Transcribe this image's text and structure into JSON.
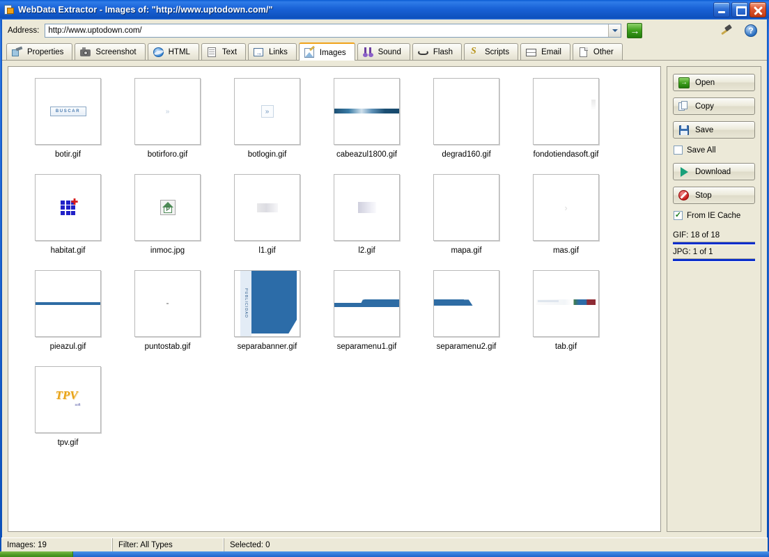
{
  "window": {
    "title": "WebData Extractor - Images of: \"http://www.uptodown.com/\"",
    "icon": "webdata-extractor-icon",
    "minimize_label": "Minimize",
    "maximize_label": "Maximize",
    "close_label": "Close"
  },
  "toolbar": {
    "address_label": "Address:",
    "address_value": "http://www.uptodown.com/",
    "address_placeholder": "http://",
    "go_label": "Go",
    "tools_icon": "hammer-icon",
    "help_icon": "help-icon",
    "help_glyph": "?"
  },
  "tabs": [
    {
      "label": "Properties",
      "icon": "properties-icon",
      "active": false
    },
    {
      "label": "Screenshot",
      "icon": "camera-icon",
      "active": false
    },
    {
      "label": "HTML",
      "icon": "browser-icon",
      "active": false
    },
    {
      "label": "Text",
      "icon": "document-icon",
      "active": false
    },
    {
      "label": "Links",
      "icon": "link-arrow-icon",
      "active": false
    },
    {
      "label": "Images",
      "icon": "image-icon",
      "active": true
    },
    {
      "label": "Sound",
      "icon": "music-note-icon",
      "active": false
    },
    {
      "label": "Flash",
      "icon": "flash-icon",
      "active": false
    },
    {
      "label": "Scripts",
      "icon": "script-icon",
      "active": false
    },
    {
      "label": "Email",
      "icon": "envelope-icon",
      "active": false
    },
    {
      "label": "Other",
      "icon": "file-icon",
      "active": false
    }
  ],
  "images": [
    {
      "name": "botir.gif",
      "art": "buscar",
      "art_text": "BUSCAR"
    },
    {
      "name": "botirforo.gif",
      "art": "chevron",
      "art_text": "»"
    },
    {
      "name": "botlogin.gif",
      "art": "chevron-box",
      "art_text": "»"
    },
    {
      "name": "cabeazul1800.gif",
      "art": "band",
      "art_text": ""
    },
    {
      "name": "degrad160.gif",
      "art": "blank",
      "art_text": ""
    },
    {
      "name": "fondotiendasoft.gif",
      "art": "corner",
      "art_text": ""
    },
    {
      "name": "habitat.gif",
      "art": "habitat",
      "art_text": ""
    },
    {
      "name": "inmoc.jpg",
      "art": "inmoc",
      "art_text": "P"
    },
    {
      "name": "l1.gif",
      "art": "grad",
      "art_text": ""
    },
    {
      "name": "l2.gif",
      "art": "grad-small",
      "art_text": ""
    },
    {
      "name": "mapa.gif",
      "art": "blank",
      "art_text": ""
    },
    {
      "name": "mas.gif",
      "art": "mas",
      "art_text": "›"
    },
    {
      "name": "pieazul.gif",
      "art": "band-solid",
      "art_text": ""
    },
    {
      "name": "puntostab.gif",
      "art": "dot",
      "art_text": ""
    },
    {
      "name": "separabanner.gif",
      "art": "publicidad",
      "art_text": "PUBLICIDAD"
    },
    {
      "name": "separamenu1.gif",
      "art": "sep1",
      "art_text": ""
    },
    {
      "name": "separamenu2.gif",
      "art": "sep2",
      "art_text": ""
    },
    {
      "name": "tab.gif",
      "art": "tabstrip",
      "art_text": ""
    },
    {
      "name": "tpv.gif",
      "art": "tpv",
      "art_text": "TPV"
    }
  ],
  "actions": {
    "open_label": "Open",
    "copy_label": "Copy",
    "save_label": "Save",
    "save_all_label": "Save All",
    "save_all_checked": false,
    "download_label": "Download",
    "stop_label": "Stop",
    "from_ie_cache_label": "From IE Cache",
    "from_ie_cache_checked": true,
    "check_glyph": "✓"
  },
  "progress": [
    {
      "label": "GIF:  18 of 18",
      "percent": 100,
      "color": "#0b2ecb"
    },
    {
      "label": "JPG:  1 of 1",
      "percent": 100,
      "color": "#0b2ecb"
    }
  ],
  "statusbar": {
    "images": "Images: 19",
    "filter": "Filter: All Types",
    "selected": "Selected: 0"
  },
  "colors": {
    "titlebar_blue": "#1a63d8",
    "active_tab_accent": "#f0a31a",
    "progress_blue": "#0b2ecb",
    "thumb_blue": "#2e6ca4",
    "go_green": "#3fa01c"
  }
}
